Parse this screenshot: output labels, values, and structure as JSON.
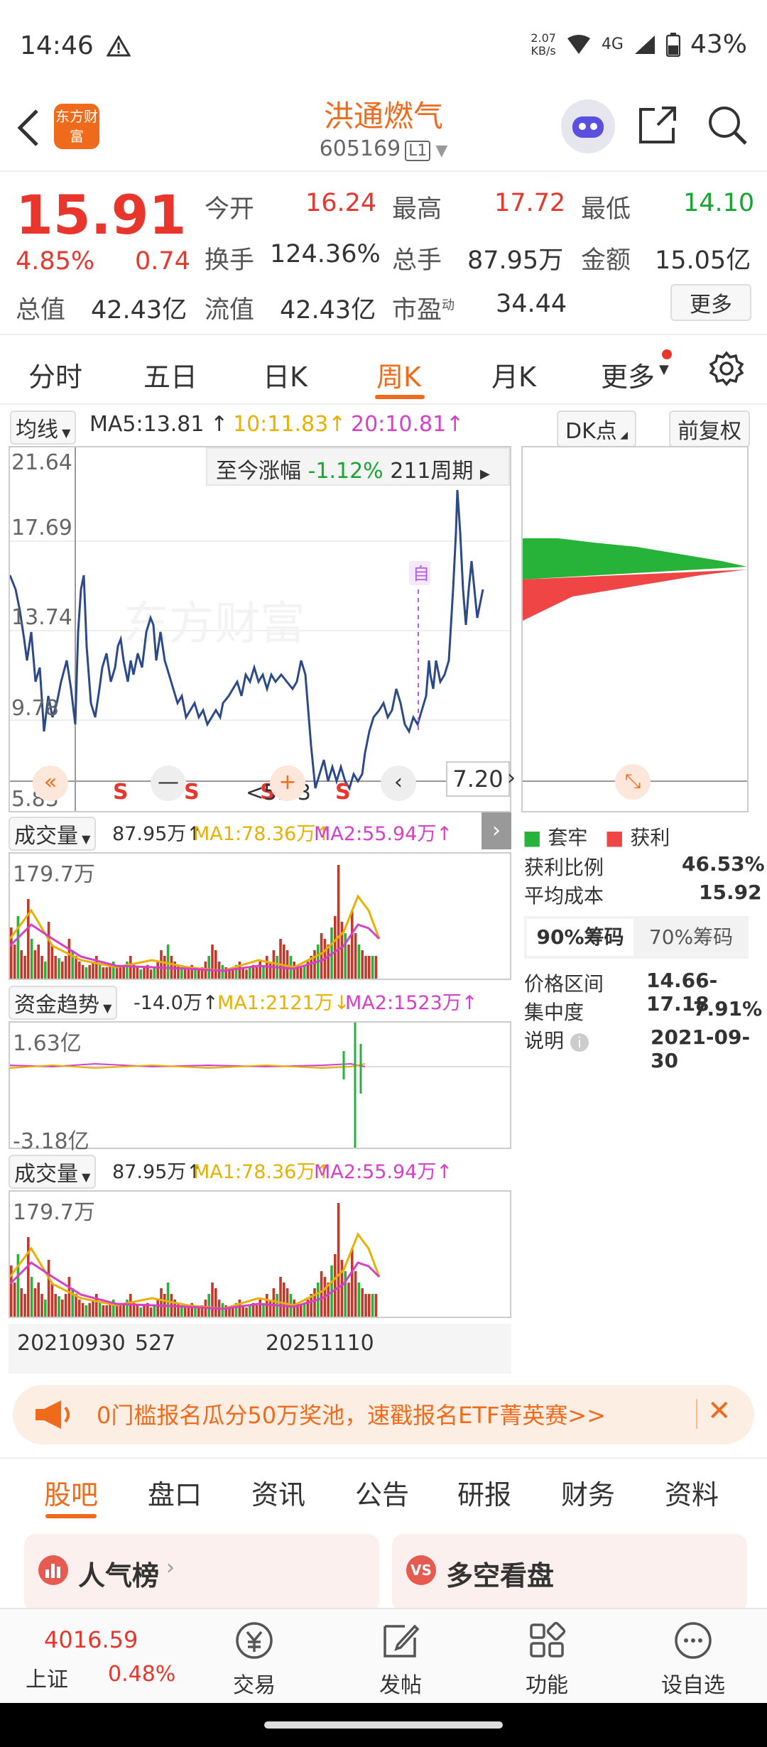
{
  "status": {
    "time": "14:46",
    "net_speed": "2.07",
    "net_unit": "KB/s",
    "signal": "4G",
    "battery": "43%"
  },
  "header": {
    "title": "洪通燃气",
    "code": "605169",
    "level": "L1",
    "logo": "东方财富"
  },
  "quote": {
    "price": "15.91",
    "change_pct": "4.85%",
    "change": "0.74",
    "open_label": "今开",
    "open": "16.24",
    "high_label": "最高",
    "high": "17.72",
    "low_label": "最低",
    "low": "14.10",
    "turnover_label": "换手",
    "turnover": "124.36%",
    "volume_label": "总手",
    "volume": "87.95万",
    "amount_label": "金额",
    "amount": "15.05亿",
    "mcap_label": "总值",
    "mcap": "42.43亿",
    "float_label": "流值",
    "float": "42.43亿",
    "pe_label": "市盈",
    "pe_sup": "动",
    "pe": "34.44",
    "more": "更多"
  },
  "tabs": [
    "分时",
    "五日",
    "日K",
    "周K",
    "月K",
    "更多"
  ],
  "active_tab": "周K",
  "chart_toolbar": {
    "ma_select": "均线",
    "ma5": "MA5:13.81",
    "ma10": "10:11.83",
    "ma20": "20:10.81",
    "dk": "DK点",
    "adjust": "前复权"
  },
  "kline": {
    "y_labels": [
      "21.64",
      "17.69",
      "13.74",
      "9.78",
      "5.83"
    ],
    "period_label": "至今涨幅",
    "period_pct": "-1.12%",
    "period_count": "211周期",
    "marker": "自",
    "low_marker": "<5.83",
    "nav_value": "7.20",
    "sell_marker": "S",
    "watermark": "东方财富"
  },
  "chip": {
    "legend_trapped": "套牢",
    "legend_profit": "获利",
    "profit_ratio_label": "获利比例",
    "profit_ratio": "46.53%",
    "avg_cost_label": "平均成本",
    "avg_cost": "15.92",
    "tab90": "90%筹码",
    "tab70": "70%筹码",
    "range_label": "价格区间",
    "range": "14.66-17.18",
    "concentration_label": "集中度",
    "concentration": "7.91%",
    "note_label": "说明",
    "note_date": "2021-09-30"
  },
  "vol1": {
    "name": "成交量",
    "value": "87.95万↑",
    "ma1": "MA1:78.36万↑",
    "ma2": "MA2:55.94万↑",
    "ymax": "179.7万"
  },
  "fund": {
    "name": "资金趋势",
    "value": "-14.0万↑",
    "ma1": "MA1:2121万↓",
    "ma2": "MA2:1523万↑",
    "ymax": "1.63亿",
    "ymin": "-3.18亿"
  },
  "vol2": {
    "name": "成交量",
    "value": "87.95万↑",
    "ma1": "MA1:78.36万↑",
    "ma2": "MA2:55.94万↑",
    "ymax": "179.7万"
  },
  "dates": {
    "start": "20210930",
    "mid": "527",
    "end": "20251110"
  },
  "banner": {
    "text": "0门槛报名瓜分50万奖池，速戳报名ETF菁英赛>>"
  },
  "subtabs": [
    "股吧",
    "盘口",
    "资讯",
    "公告",
    "研报",
    "财务",
    "资料"
  ],
  "cards": {
    "left": "人气榜",
    "right": "多空看盘"
  },
  "bottom": {
    "index_value": "4016.59",
    "index_name": "上证",
    "index_pct": "0.48%",
    "items": [
      "交易",
      "发帖",
      "功能",
      "设自选"
    ]
  },
  "colors": {
    "accent": "#f06a1b",
    "up": "#e8362d",
    "down": "#18a531",
    "kline": "#2c4a8a"
  }
}
